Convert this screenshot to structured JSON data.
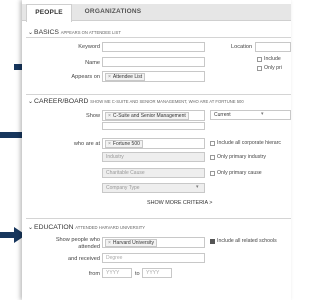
{
  "tabs": {
    "people": "PEOPLE",
    "organizations": "ORGANIZATIONS"
  },
  "basics": {
    "title": "BASICS",
    "subtitle": "APPEARS ON ATTENDEE LIST",
    "keyword_label": "Keyword",
    "location_label": "Location",
    "name_label": "Name",
    "appears_on_label": "Appears on",
    "appears_on_tag": "Attendee List",
    "include_label": "Include",
    "only_primary_label": "Only pri"
  },
  "career": {
    "title": "CAREER/BOARD",
    "subtitle": "SHOW ME C-SUITE AND SENIOR MANAGEMENT, WHO ARE AT FORTUNE 500",
    "show_label": "Show",
    "show_tag": "C-Suite and Senior Management",
    "current_value": "Current",
    "who_are_at_label": "who are at",
    "who_are_at_tag": "Fortune 500",
    "include_all_corp": "Include all corporate hierarc",
    "industry_placeholder": "Industry",
    "only_primary_industry": "Only primary industry",
    "charitable_placeholder": "Charitable Cause",
    "only_primary_cause": "Only primary cause",
    "company_type_placeholder": "Company Type",
    "show_more": "SHOW MORE CRITERIA >"
  },
  "education": {
    "title": "EDUCATION",
    "subtitle": "ATTENDED HARVARD UNIVERSITY",
    "show_people_label": "Show people who",
    "attended_label": "attended",
    "received_label": "and received",
    "school_tag": "Harvard University",
    "include_related": "Include all related schools",
    "degree_placeholder": "Degree",
    "from_label": "from",
    "to_label": "to",
    "from_placeholder": "YYYY",
    "to_placeholder": "YYYY"
  },
  "icons": {
    "remove": "close-icon",
    "collapse": "chevron-down-icon",
    "pointer": "arrow-right-icon"
  },
  "colors": {
    "arrow": "#17365d",
    "accent_tag": "#f3f3f3"
  }
}
